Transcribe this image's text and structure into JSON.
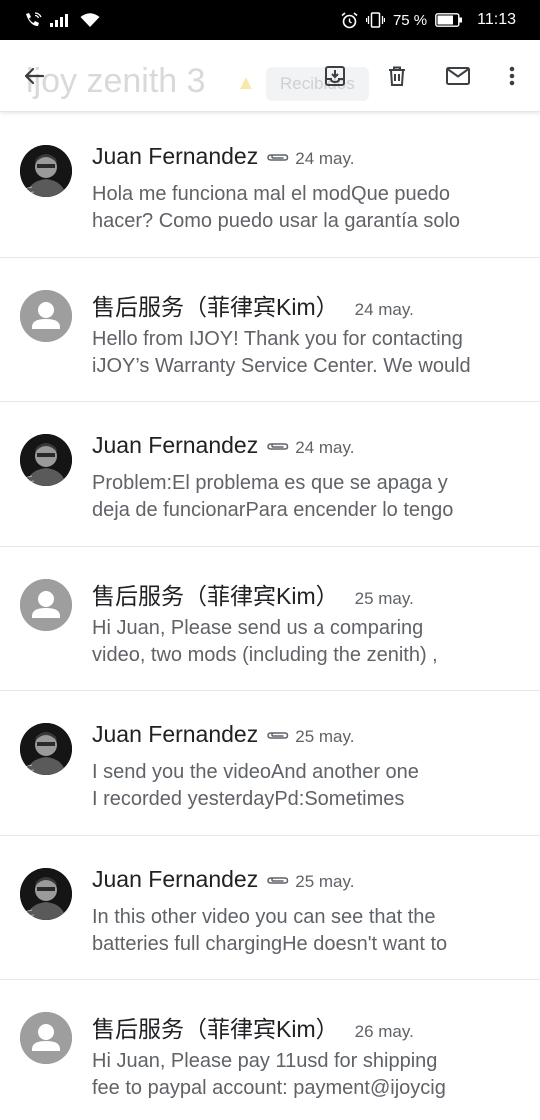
{
  "status_bar": {
    "battery": "75 %",
    "time": "11:13",
    "icons": [
      "phone-wifi-call-icon",
      "signal-icon",
      "wifi-icon",
      "alarm-icon",
      "vibrate-icon",
      "battery-icon"
    ]
  },
  "toolbar": {
    "subject": "ijoy zenith 3",
    "label": "Recibidos",
    "icons": [
      "back-arrow-icon",
      "archive-icon",
      "delete-icon",
      "mark-unread-icon",
      "more-vert-icon"
    ]
  },
  "colors": {
    "generic_avatar": "#9e9e9e",
    "snippet_gray": "#5f6368"
  },
  "messages": [
    {
      "sender": "Juan Fernandez",
      "has_attachment": true,
      "date": "24 may.",
      "avatar": "photo",
      "line1": "Hola me funciona mal el modQue puedo",
      "line2": "hacer? Como puedo usar la garantía solo"
    },
    {
      "sender": "售后服务（菲律宾Kim）",
      "has_attachment": false,
      "date": "24 may.",
      "avatar": "generic",
      "line1": "Hello from IJOY! Thank you for contacting",
      "line2": "iJOY’s Warranty Service Center. We would"
    },
    {
      "sender": "Juan Fernandez",
      "has_attachment": true,
      "date": "24 may.",
      "avatar": "photo",
      "line1": "Problem:El problema es que se apaga y",
      "line2": "deja de funcionarPara encender lo tengo"
    },
    {
      "sender": "售后服务（菲律宾Kim）",
      "has_attachment": false,
      "date": "25 may.",
      "avatar": "generic",
      "line1": "Hi Juan, Please send us a comparing",
      "line2": "video, two mods (including the zenith) ,"
    },
    {
      "sender": "Juan Fernandez",
      "has_attachment": true,
      "date": "25 may.",
      "avatar": "photo",
      "line1": "I send you the videoAnd another one",
      "line2": "I recorded yesterdayPd:Sometimes"
    },
    {
      "sender": "Juan Fernandez",
      "has_attachment": true,
      "date": "25 may.",
      "avatar": "photo",
      "line1": "In this other video you can see that the",
      "line2": "batteries full chargingHe doesn't want to"
    },
    {
      "sender": "售后服务（菲律宾Kim）",
      "has_attachment": false,
      "date": "26 may.",
      "avatar": "generic",
      "line1": "Hi Juan, Please pay 11usd for shipping",
      "line2": "fee to paypal account: payment@ijoycig"
    }
  ]
}
